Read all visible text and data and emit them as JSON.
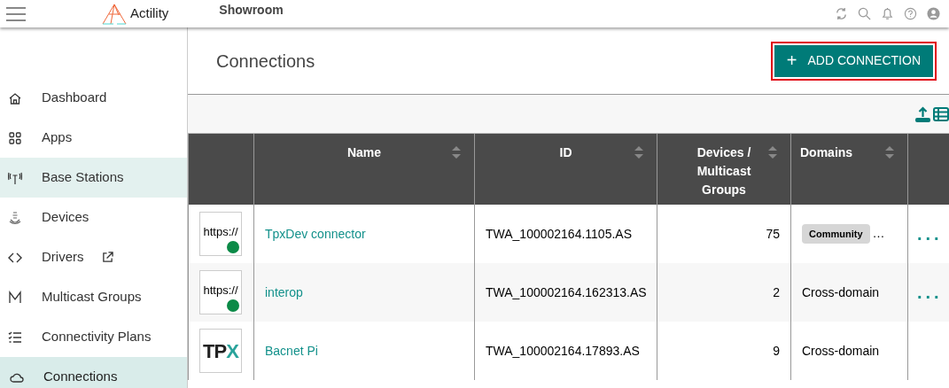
{
  "topbar": {
    "brand": "Actility",
    "title": "Showroom"
  },
  "sidebar": {
    "items": [
      {
        "label": "Dashboard",
        "selected": false,
        "hovered": false,
        "external": false
      },
      {
        "label": "Apps",
        "selected": false,
        "hovered": false,
        "external": false
      },
      {
        "label": "Base Stations",
        "selected": false,
        "hovered": true,
        "external": false
      },
      {
        "label": "Devices",
        "selected": false,
        "hovered": false,
        "external": false
      },
      {
        "label": "Drivers",
        "selected": false,
        "hovered": false,
        "external": true
      },
      {
        "label": "Multicast Groups",
        "selected": false,
        "hovered": false,
        "external": false
      },
      {
        "label": "Connectivity Plans",
        "selected": false,
        "hovered": false,
        "external": false
      },
      {
        "label": "Connections",
        "selected": true,
        "hovered": false,
        "external": false
      }
    ]
  },
  "page": {
    "title": "Connections",
    "add_button": {
      "icon": "+",
      "label": "ADD CONNECTION"
    }
  },
  "table": {
    "columns": [
      "",
      "Name",
      "ID",
      "Devices / Multicast Groups",
      "Domains",
      ""
    ],
    "rows": [
      {
        "logo": {
          "kind": "https",
          "text": "https://",
          "color": "#0b8a47"
        },
        "name": "TpxDev connector",
        "id": "TWA_100002164.1105.AS",
        "devices": "75",
        "domain": {
          "kind": "badge",
          "text": "Community",
          "more": "…"
        },
        "actions": "..."
      },
      {
        "logo": {
          "kind": "https",
          "text": "https://",
          "color": "#0b8a47"
        },
        "name": "interop",
        "id": "TWA_100002164.162313.AS",
        "devices": "2",
        "domain": {
          "kind": "text",
          "text": "Cross-domain"
        },
        "actions": "..."
      },
      {
        "logo": {
          "kind": "tpx",
          "text": "TPX"
        },
        "name": "Bacnet Pi",
        "id": "TWA_100002164.17893.AS",
        "devices": "9",
        "domain": {
          "kind": "text",
          "text": "Cross-domain"
        }
      }
    ]
  }
}
